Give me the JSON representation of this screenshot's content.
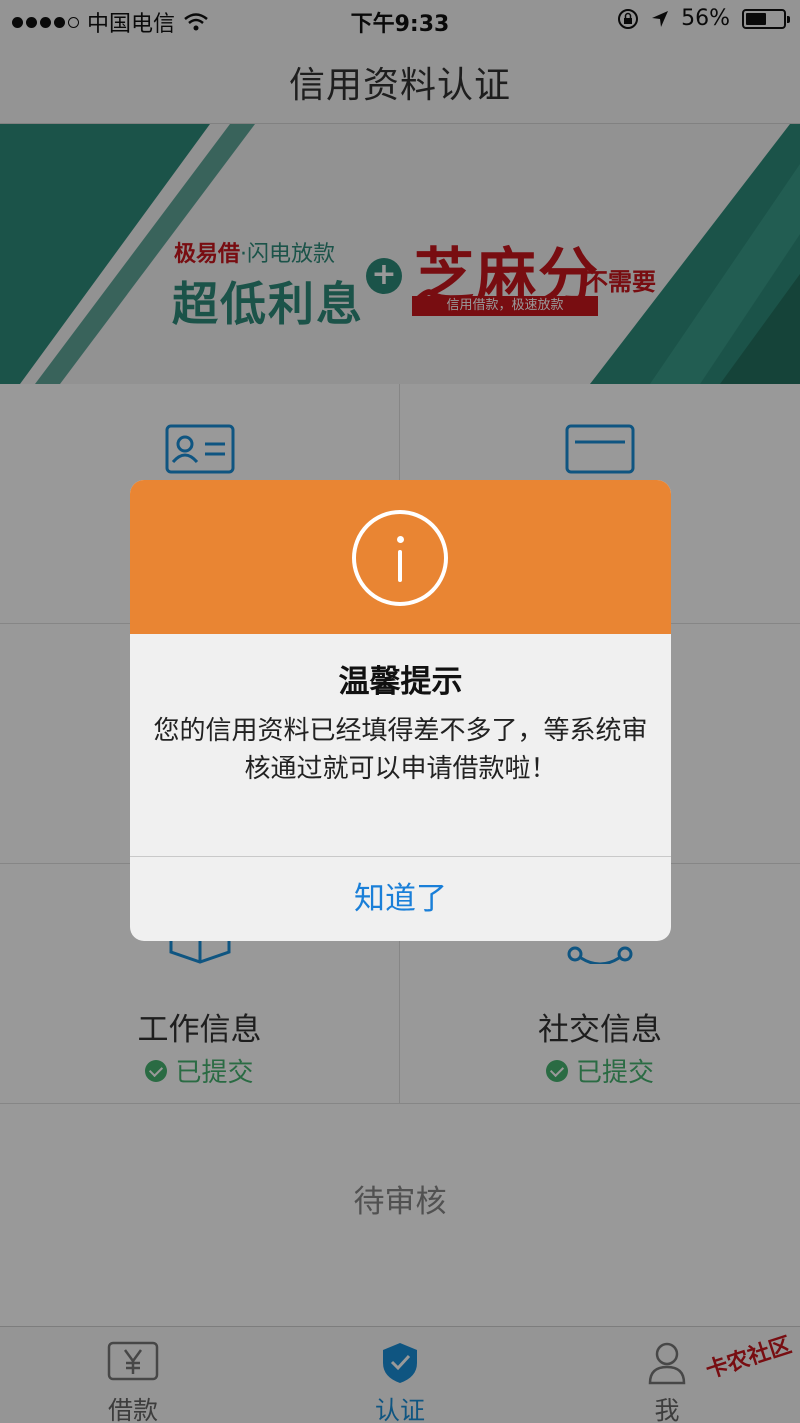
{
  "status_bar": {
    "carrier": "中国电信",
    "time": "下午9:33",
    "battery": "56%",
    "battery_level": 0.56
  },
  "nav": {
    "title": "信用资料认证"
  },
  "banner": {
    "brand": "极易借",
    "brand_sub": "·闪电放款",
    "headline": "超低利息",
    "plus": "+",
    "sesame": "芝麻分",
    "not_needed": "不需要",
    "tagline": "信用借款，极速放款",
    "colors": {
      "green": "#2e8b7a",
      "red": "#c8161d"
    }
  },
  "grid": {
    "work": {
      "label": "工作信息",
      "status": "已提交"
    },
    "social": {
      "label": "社交信息",
      "status": "已提交"
    },
    "status_color": "#46b270"
  },
  "pending": {
    "text": "待审核"
  },
  "tabs": [
    {
      "label": "借款",
      "icon": "yen-icon"
    },
    {
      "label": "认证",
      "icon": "shield-check-icon",
      "active": true
    },
    {
      "label": "我",
      "icon": "person-icon"
    }
  ],
  "watermark": "卡农社区",
  "dialog": {
    "title": "温馨提示",
    "message": "您的信用资料已经填得差不多了，等系统审核通过就可以申请借款啦！",
    "button": "知道了",
    "header_color": "#e98533"
  }
}
